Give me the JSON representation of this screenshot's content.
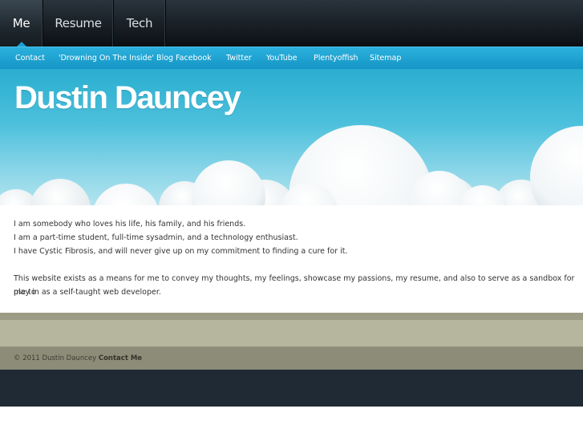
{
  "topnav": {
    "tabs": [
      {
        "label": "Me",
        "active": true
      },
      {
        "label": "Resume",
        "active": false
      },
      {
        "label": "Tech",
        "active": false
      }
    ]
  },
  "subnav": {
    "links": [
      "Contact",
      "'Drowning On The Inside' Blog",
      "Facebook",
      "Twitter",
      "YouTube",
      "Plentyoffish",
      "Sitemap"
    ]
  },
  "header": {
    "title": "Dustin Dauncey"
  },
  "content": {
    "line1": "I am somebody who loves his life, his family, and his friends.",
    "line2": "I am a part-time student, full-time sysadmin, and a technology enthusiast.",
    "line3": "I have Cystic Fibrosis, and will never give up on my commitment to finding a cure for it.",
    "para2_line1": "This website exists as a means for me to convey my thoughts, my feelings, showcase my passions, my resume, and also to serve as a sandbox for me to",
    "para2_line2": "play in as a self-taught web developer."
  },
  "footer": {
    "copyright": "© 2011 Dustin Dauncey",
    "contact_label": "Contact Me"
  },
  "colors": {
    "nav_dark": "#1b2229",
    "subnav_blue": "#1596c6",
    "sky_blue": "#2aaecf",
    "footer_khaki": "#b6b59e",
    "bottom_navy": "#202a34"
  }
}
